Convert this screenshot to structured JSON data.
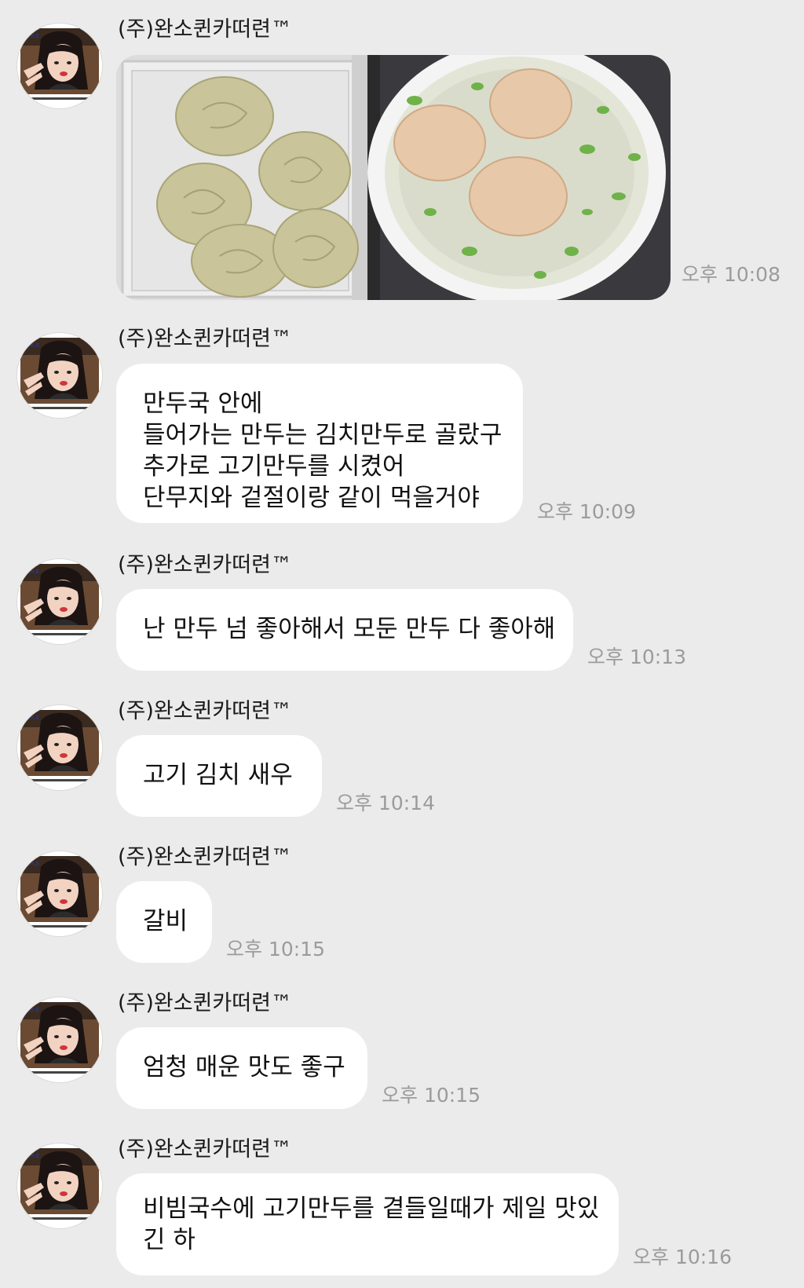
{
  "sender_name": "(주)완소퀸카떠련™",
  "messages": [
    {
      "type": "image",
      "image_alt": "만두",
      "time": "오후 10:08"
    },
    {
      "type": "text",
      "lines": [
        " 만두국 안에",
        "들어가는 만두는 김치만두로 골랐구",
        "추가로 고기만두를 시켰어",
        "단무지와 겉절이랑 같이 먹을거야"
      ],
      "time": "오후 10:09"
    },
    {
      "type": "text",
      "lines": [
        "난 만두 넘 좋아해서 모둔 만두 다 좋아해"
      ],
      "time": "오후 10:13"
    },
    {
      "type": "text",
      "lines": [
        "고기 김치 새우"
      ],
      "time": "오후 10:14"
    },
    {
      "type": "text",
      "lines": [
        "갈비"
      ],
      "time": "오후 10:15"
    },
    {
      "type": "text",
      "lines": [
        "엄청 매운 맛도 좋구"
      ],
      "time": "오후 10:15"
    },
    {
      "type": "text",
      "lines": [
        "비빔국수에 고기만두를 곁들일때가 제일 맛있",
        "긴 하"
      ],
      "time": "오후 10:16"
    }
  ],
  "colors": {
    "background": "#ebebeb",
    "bubble": "#ffffff",
    "timestamp": "#9b9b9b",
    "text": "#111111"
  }
}
